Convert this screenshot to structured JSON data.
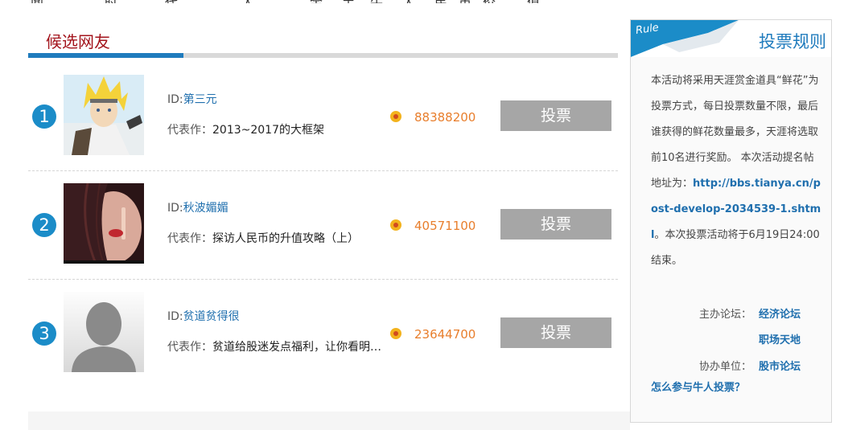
{
  "top_strip": [
    "闻",
    "时",
    "代",
    "人",
    "金",
    "手",
    "牛",
    "人",
    "民",
    "币",
    "价",
    "值"
  ],
  "section_title": "候选网友",
  "candidates": [
    {
      "rank": "1",
      "id_prefix": "ID:",
      "name": "第三元",
      "works_label": "代表作：",
      "works_title": "2013~2017的大框架",
      "count": "88388200",
      "vote_label": "投票"
    },
    {
      "rank": "2",
      "id_prefix": "ID:",
      "name": "秋波媚媚",
      "works_label": "代表作：",
      "works_title": "探访人民币的升值攻略（上）",
      "count": "40571100",
      "vote_label": "投票"
    },
    {
      "rank": "3",
      "id_prefix": "ID:",
      "name": "贫道贫得很",
      "works_label": "代表作：",
      "works_title": "贫道给股迷发点福利，让你看明…",
      "count": "23644700",
      "vote_label": "投票"
    }
  ],
  "rule": {
    "tag": "Rule",
    "title": "投票规则",
    "body_before_link": "本活动将采用天涯赏金道具“鲜花”为投票方式，每日投票数量不限，最后谁获得的鲜花数量最多，天涯将选取前10名进行奖励。 本次活动提名帖地址为：",
    "link": "http://bbs.tianya.cn/post-develop-2034539-1.shtml",
    "body_after_link": "。本次投票活动将于6月19日24:00结束。",
    "host_label": "主办论坛：",
    "host_forum_1": "经济论坛",
    "host_forum_2": "职场天地",
    "co_label": "协办单位：",
    "co_forum": "股市论坛",
    "how_link": "怎么参与牛人投票？"
  },
  "colors": {
    "accent_blue": "#1f7bbd",
    "title_red": "#a3141c",
    "count_orange": "#e87e2c",
    "button_gray": "#a6a6a6",
    "rank_blue": "#1b8cc8"
  }
}
